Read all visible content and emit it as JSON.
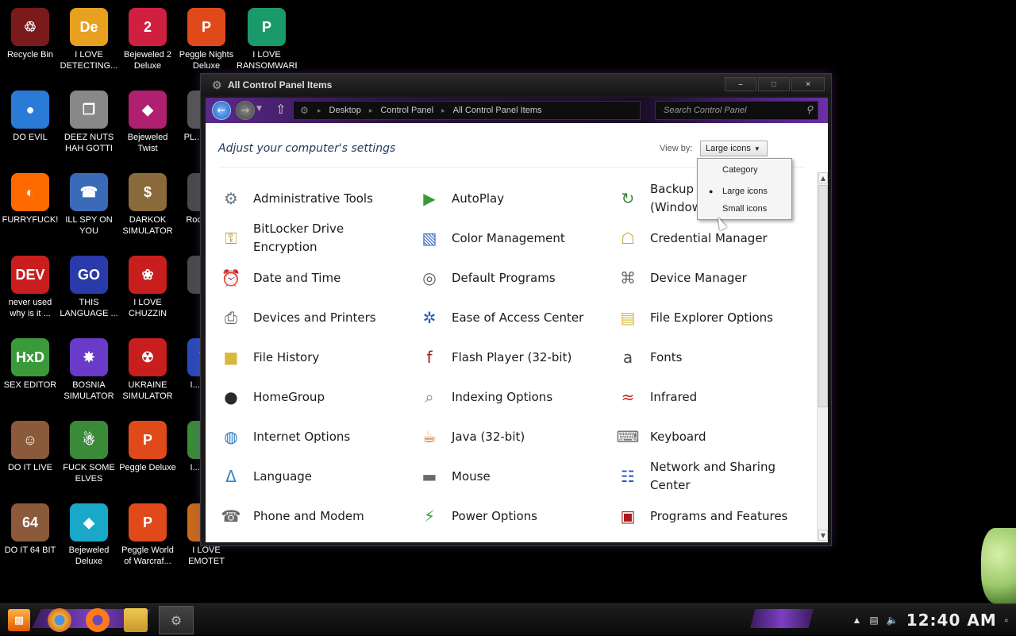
{
  "desktop": {
    "icons": [
      {
        "label": "Recycle Bin",
        "color": "#7a1a1a",
        "glyph": "♲"
      },
      {
        "label": "I LOVE DETECTING...",
        "color": "#e8a020",
        "glyph": "De"
      },
      {
        "label": "Bejeweled 2 Deluxe",
        "color": "#d02040",
        "glyph": "2"
      },
      {
        "label": "Peggle Nights Deluxe",
        "color": "#e04a1a",
        "glyph": "P"
      },
      {
        "label": "I LOVE RANSOMWARE",
        "color": "#1a9a6a",
        "glyph": "P"
      },
      {
        "label": "DO EVIL",
        "color": "#2a7ad8",
        "glyph": "●"
      },
      {
        "label": "DEEZ NUTS HAH GOTTI",
        "color": "#888888",
        "glyph": "❐"
      },
      {
        "label": "Bejeweled Twist",
        "color": "#b02070",
        "glyph": "◆"
      },
      {
        "label": "PL... MET...",
        "color": "#555555",
        "glyph": "♠"
      },
      {
        "label": "FURRYFUCK!",
        "color": "#ff6a00",
        "glyph": "◐"
      },
      {
        "label": "ILL SPY ON YOU",
        "color": "#3a6ab8",
        "glyph": "☎"
      },
      {
        "label": "DARKOK SIMULATOR",
        "color": "#8a6a3a",
        "glyph": "$"
      },
      {
        "label": "Rocl... D...",
        "color": "#4a4a4a",
        "glyph": "★"
      },
      {
        "label": "never used why is it ...",
        "color": "#c81e1e",
        "glyph": "DEV"
      },
      {
        "label": "THIS LANGUAGE ...",
        "color": "#2a3aa8",
        "glyph": "GO"
      },
      {
        "label": "I LOVE CHUZZIN",
        "color": "#c81e1e",
        "glyph": "❀"
      },
      {
        "label": "...",
        "color": "#4a4a4a",
        "glyph": "♦"
      },
      {
        "label": "SEX EDITOR",
        "color": "#3a9a3a",
        "glyph": "HxD"
      },
      {
        "label": "BOSNIA SIMULATOR",
        "color": "#6a3ac8",
        "glyph": "✸"
      },
      {
        "label": "UKRAINE SIMULATOR",
        "color": "#c81e1e",
        "glyph": "☢"
      },
      {
        "label": "I... MA...",
        "color": "#2a4ab8",
        "glyph": "W"
      },
      {
        "label": "DO IT LIVE",
        "color": "#8a5a3a",
        "glyph": "☺"
      },
      {
        "label": "FUCK SOME ELVES",
        "color": "#3a8a3a",
        "glyph": "☃"
      },
      {
        "label": "Peggle Deluxe",
        "color": "#e04a1a",
        "glyph": "P"
      },
      {
        "label": "I... MA...",
        "color": "#3a8a3a",
        "glyph": "☆"
      },
      {
        "label": "DO IT 64 BIT",
        "color": "#8a5a3a",
        "glyph": "64"
      },
      {
        "label": "Bejeweled Deluxe",
        "color": "#1aa8c8",
        "glyph": "◆"
      },
      {
        "label": "Peggle World of Warcraf...",
        "color": "#e04a1a",
        "glyph": "P"
      },
      {
        "label": "I LOVE EMOTET",
        "color": "#c86a1a",
        "glyph": "I"
      }
    ]
  },
  "window": {
    "title": "All Control Panel Items",
    "minimize": "–",
    "maximize": "□",
    "close": "×",
    "breadcrumb": [
      "Desktop",
      "Control Panel",
      "All Control Panel Items"
    ],
    "search_placeholder": "Search Control Panel",
    "heading": "Adjust your computer's settings",
    "viewby_label": "View by:",
    "viewby_value": "Large icons",
    "menu": [
      "Category",
      "Large icons",
      "Small icons"
    ],
    "menu_selected": "Large icons"
  },
  "items": [
    {
      "label": "Administrative Tools",
      "icon": "admin-tools-icon",
      "glyph": "⚙",
      "color": "#6a7a8a"
    },
    {
      "label": "AutoPlay",
      "icon": "autoplay-icon",
      "glyph": "▶",
      "color": "#3a9a3a"
    },
    {
      "label": "Backup and Restore (Windows 7)",
      "icon": "backup-icon",
      "glyph": "↻",
      "color": "#3a8a3a"
    },
    {
      "label": "BitLocker Drive Encryption",
      "icon": "bitlocker-icon",
      "glyph": "⚿",
      "color": "#b89a3a"
    },
    {
      "label": "Color Management",
      "icon": "color-management-icon",
      "glyph": "▧",
      "color": "#3a6ac8"
    },
    {
      "label": "Credential Manager",
      "icon": "credential-manager-icon",
      "glyph": "☖",
      "color": "#c8a83a"
    },
    {
      "label": "Date and Time",
      "icon": "date-time-icon",
      "glyph": "⏰",
      "color": "#3a7ac8"
    },
    {
      "label": "Default Programs",
      "icon": "default-programs-icon",
      "glyph": "◎",
      "color": "#5a5a5a"
    },
    {
      "label": "Device Manager",
      "icon": "device-manager-icon",
      "glyph": "⌘",
      "color": "#6a6a6a"
    },
    {
      "label": "Devices and Printers",
      "icon": "printer-icon",
      "glyph": "⎙",
      "color": "#5a5a5a"
    },
    {
      "label": "Ease of Access Center",
      "icon": "ease-of-access-icon",
      "glyph": "✲",
      "color": "#2a5ab8"
    },
    {
      "label": "File Explorer Options",
      "icon": "folder-options-icon",
      "glyph": "▤",
      "color": "#d8b83a"
    },
    {
      "label": "File History",
      "icon": "file-history-icon",
      "glyph": "■",
      "color": "#d8b83a"
    },
    {
      "label": "Flash Player (32-bit)",
      "icon": "flash-player-icon",
      "glyph": "f",
      "color": "#a81a1a"
    },
    {
      "label": "Fonts",
      "icon": "fonts-icon",
      "glyph": "a",
      "color": "#4a4a4a"
    },
    {
      "label": "HomeGroup",
      "icon": "homegroup-icon",
      "glyph": "●",
      "color": "#2a2a2a"
    },
    {
      "label": "Indexing Options",
      "icon": "indexing-icon",
      "glyph": "⌕",
      "color": "#6a8aa8"
    },
    {
      "label": "Infrared",
      "icon": "infrared-icon",
      "glyph": "≈",
      "color": "#c81e1e"
    },
    {
      "label": "Internet Options",
      "icon": "internet-options-icon",
      "glyph": "◍",
      "color": "#2a7ac8"
    },
    {
      "label": "Java (32-bit)",
      "icon": "java-icon",
      "glyph": "☕",
      "color": "#c86a1a"
    },
    {
      "label": "Keyboard",
      "icon": "keyboard-icon",
      "glyph": "⌨",
      "color": "#6a6a6a"
    },
    {
      "label": "Language",
      "icon": "language-icon",
      "glyph": "Δ",
      "color": "#2a8ac8"
    },
    {
      "label": "Mouse",
      "icon": "mouse-icon",
      "glyph": "▬",
      "color": "#6a6a6a"
    },
    {
      "label": "Network and Sharing Center",
      "icon": "network-icon",
      "glyph": "☷",
      "color": "#2a5ab8"
    },
    {
      "label": "Phone and Modem",
      "icon": "phone-modem-icon",
      "glyph": "☎",
      "color": "#6a6a6a"
    },
    {
      "label": "Power Options",
      "icon": "power-options-icon",
      "glyph": "⚡",
      "color": "#3a9a3a"
    },
    {
      "label": "Programs and Features",
      "icon": "programs-features-icon",
      "glyph": "▣",
      "color": "#a81a1a"
    }
  ],
  "taskbar": {
    "clock": "12:40 AM",
    "apps": [
      "chrome-icon",
      "firefox-icon",
      "file-explorer-icon"
    ]
  }
}
